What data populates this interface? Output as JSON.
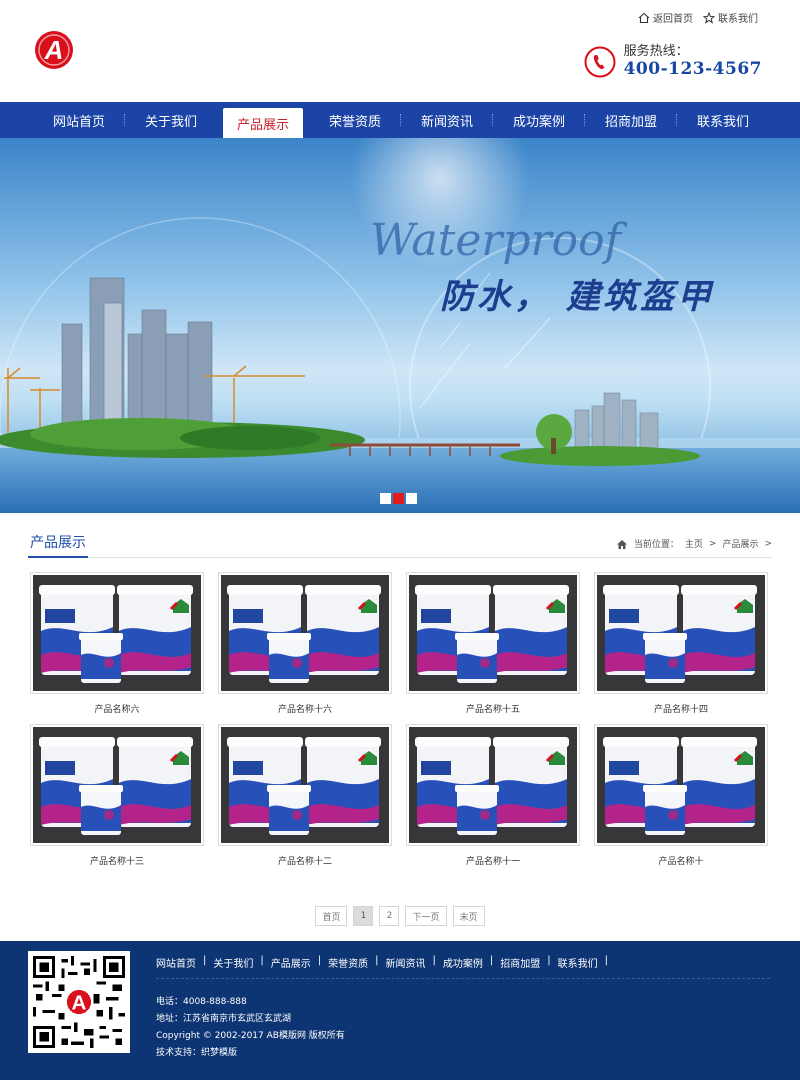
{
  "header": {
    "top_links": [
      {
        "label": "返回首页",
        "icon": "home-icon"
      },
      {
        "label": "联系我们",
        "icon": "star-icon"
      }
    ],
    "hotline_label": "服务热线：",
    "hotline_number": "400-123-4567",
    "logo_icon": "logo-a-icon",
    "logo_letter": "A"
  },
  "nav": {
    "items": [
      "网站首页",
      "关于我们",
      "产品展示",
      "荣誉资质",
      "新闻资讯",
      "成功案例",
      "招商加盟",
      "联系我们"
    ],
    "active_index": 2
  },
  "banner": {
    "script_text": "Waterproof",
    "slogan": "防水， 建筑盔甲",
    "slides": 3,
    "active_slide": 2
  },
  "section": {
    "title": "产品展示",
    "breadcrumb_label": "当前位置：",
    "breadcrumb": [
      "主页",
      "产品展示"
    ],
    "separator": ">"
  },
  "products": [
    "产品名称六",
    "产品名称十六",
    "产品名称十五",
    "产品名称十四",
    "产品名称十三",
    "产品名称十二",
    "产品名称十一",
    "产品名称十"
  ],
  "pager": [
    "首页",
    "1",
    "2",
    "下一页",
    "末页"
  ],
  "pager_current": "1",
  "footer": {
    "links": [
      "网站首页",
      "关于我们",
      "产品展示",
      "荣誉资质",
      "新闻资讯",
      "成功案例",
      "招商加盟",
      "联系我们"
    ],
    "phone": "电话：4008-888-888",
    "address": "地址：江苏省南京市玄武区玄武湖",
    "copyright": "Copyright © 2002-2017 AB模版网 版权所有",
    "support": "技术支持：织梦模版"
  },
  "colors": {
    "nav_bg": "#1c44a7",
    "accent_red": "#e21a1a",
    "footer_bg": "#0d3473",
    "title_blue": "#1f4fa8"
  }
}
